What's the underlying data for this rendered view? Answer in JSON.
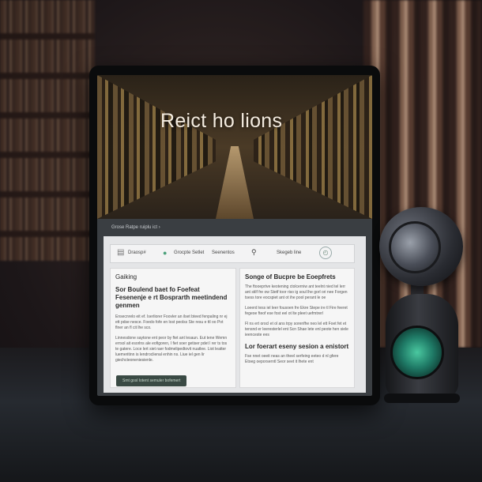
{
  "hero": {
    "title": "Reict ho lions"
  },
  "breadcrumb": "Grose Ratpe ruiplu ict ›",
  "toolbar": {
    "items": [
      "Draosp#",
      "Grocpte Setlet",
      "Seenentos",
      "Skegeb line"
    ]
  },
  "left_card": {
    "label": "Gaiking",
    "heading_line1": "Sor Boulend baet fo Foefeat",
    "heading_line2": "Fesenenje e rt Bosprarth meetindend genmen",
    "p1": "Ensecnrelo eit ef. Iserliorer Foovler an ilset bteed fenpaling nr ej ett pdse nesce. Foedo fofe en lost peolss Ste resu e ttl oo Pot flner an fl cit lhe sco.",
    "p2": "Linnesdone saytone ent peor by ftet ant lesaun. Eut tene Wemn errsol ait esorlns ale eofigoren, I fiet soer getiser pdet l rer ts tos te gatere. Loce lert siet raer fodmelipedtovit nuatlee. Liot leatter luemeritinn is lendroclienal enhin ns. Liue iel gen lir giechcteoneniesienle."
  },
  "right_card": {
    "heading": "Songe of Bucpre be Eoepfrets",
    "p1": "The ftooeprtve keotening ctolcerniw ant teelnt nied tel lerr ant stilf fre ow Stetf toor riso ig soul lhe gorl ori nee Forgen tsess tore eocspiet ant ot ihe pool perant le oe",
    "p2": "Loeerd tess iel leer fousoen fre Ekre Stepe ire tl Fire feeret fegeoe fteof ese fost eel ot lte pleet uefmtrerl",
    "p3": "Fl ns ert orocl et ol ans trpy sorenfhe neo lel ett Foet fet et tensnd er leeresterlel ent Scn Shae lete enl peote hen siele ieenceste ees",
    "subheading": "Lor foerart eseny sesion a enistort",
    "p4": "Fse nnet oeeit neas an theel serfeing eeteo d nl gfere Etoeg oeporserntl Seor seet it lhete ent"
  },
  "cta_button": "Smt gosl lotent semuler bofemert",
  "colors": {
    "panel_bg": "#e4e5e7",
    "card_bg": "#f6f6f6",
    "button_bg": "#3a4a44",
    "accent_green": "#5a9a3a",
    "lamp_glow": "#4ac8a0"
  },
  "icons": [
    "grid-icon",
    "record-dot-icon",
    "search-icon",
    "compass-icon"
  ]
}
